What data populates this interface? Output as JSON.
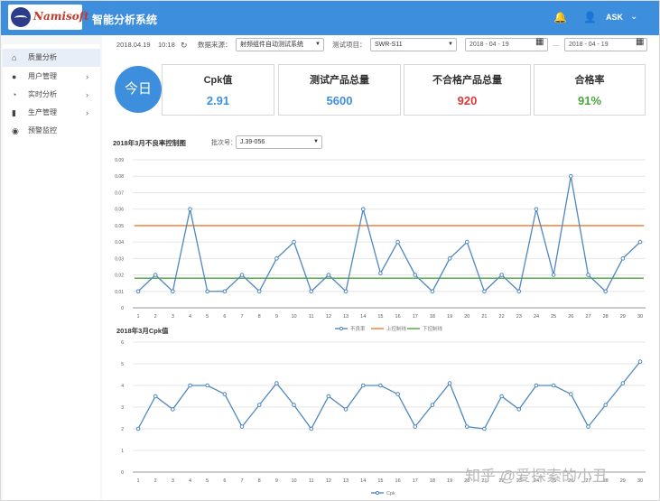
{
  "app": {
    "logo_text": "Namisoft",
    "title": "智能分析系统",
    "user": "ASK"
  },
  "colors": {
    "primary": "#3d8fde",
    "series": "#4f87c0",
    "ucl": "#f07a2a",
    "lcl": "#4aa53a",
    "red": "#d83a3a",
    "green": "#4aa53a"
  },
  "sidebar": {
    "items": [
      {
        "label": "质量分析",
        "icon": "home-icon",
        "active": true
      },
      {
        "label": "用户管理",
        "icon": "user-icon",
        "chevron": "chevron-right-icon"
      },
      {
        "label": "实时分析",
        "icon": "pie-chart-icon",
        "chevron": "chevron-right-icon"
      },
      {
        "label": "生产管理",
        "icon": "document-icon",
        "chevron": "chevron-right-icon"
      },
      {
        "label": "预警监控",
        "icon": "eye-icon"
      }
    ]
  },
  "filters": {
    "date": "2018.04.19",
    "time": "10:18",
    "source_label": "数据来源：",
    "source_value": "射频组件自动测试系统",
    "project_label": "测试项目：",
    "project_value": "SWR-S11",
    "date_start": "2018 - 04 - 19",
    "date_sep": "—",
    "date_end": "2018 - 04 - 19"
  },
  "today": "今日",
  "cards": [
    {
      "title": "Cpk值",
      "value": "2.91"
    },
    {
      "title": "测试产品总量",
      "value": "5600"
    },
    {
      "title": "不合格产品总量",
      "value": "920"
    },
    {
      "title": "合格率",
      "value": "91%"
    }
  ],
  "chart1_header": {
    "title": "2018年3月不良率控制图",
    "batch_label": "批次号：",
    "batch_value": "J.39-056"
  },
  "chart2_header": {
    "title": "2018年3月Cpk值"
  },
  "watermark": "知乎 @爱探索的小丑",
  "chart_data": [
    {
      "type": "line",
      "x": [
        1,
        2,
        3,
        4,
        5,
        6,
        7,
        8,
        9,
        10,
        11,
        12,
        13,
        14,
        15,
        16,
        17,
        18,
        19,
        20,
        21,
        22,
        23,
        24,
        25,
        26,
        27,
        28,
        29,
        30
      ],
      "ylim": [
        0,
        0.09
      ],
      "yticks": [
        "0",
        "0.01",
        "0.02",
        "0.03",
        "0.04",
        "0.05",
        "0.06",
        "0.07",
        "0.08",
        "0.09"
      ],
      "series": [
        {
          "name": "不良率",
          "values": [
            0.01,
            0.02,
            0.01,
            0.06,
            0.01,
            0.01,
            0.02,
            0.01,
            0.03,
            0.04,
            0.01,
            0.02,
            0.01,
            0.06,
            0.021,
            0.04,
            0.02,
            0.01,
            0.03,
            0.04,
            0.01,
            0.02,
            0.01,
            0.06,
            0.02,
            0.08,
            0.02,
            0.01,
            0.03,
            0.04
          ]
        },
        {
          "name": "上控制线",
          "constant": 0.05
        },
        {
          "name": "下控制线",
          "constant": 0.018
        }
      ],
      "legend_position": "bottom",
      "grid": true
    },
    {
      "type": "line",
      "x": [
        1,
        2,
        3,
        4,
        5,
        6,
        7,
        8,
        9,
        10,
        11,
        12,
        13,
        14,
        15,
        16,
        17,
        18,
        19,
        20,
        21,
        22,
        23,
        24,
        25,
        26,
        27,
        28,
        29,
        30
      ],
      "ylim": [
        0,
        6
      ],
      "yticks": [
        "0",
        "1",
        "2",
        "3",
        "4",
        "5",
        "6"
      ],
      "series": [
        {
          "name": "Cpk",
          "values": [
            2.0,
            3.5,
            2.9,
            4.0,
            4.0,
            3.6,
            2.1,
            3.1,
            4.1,
            3.1,
            2.0,
            3.5,
            2.9,
            4.0,
            4.0,
            3.6,
            2.1,
            3.1,
            4.1,
            2.1,
            2.0,
            3.5,
            2.9,
            4.0,
            4.0,
            3.6,
            2.1,
            3.1,
            4.1,
            5.1
          ]
        }
      ],
      "legend_position": "bottom",
      "grid": true
    }
  ]
}
